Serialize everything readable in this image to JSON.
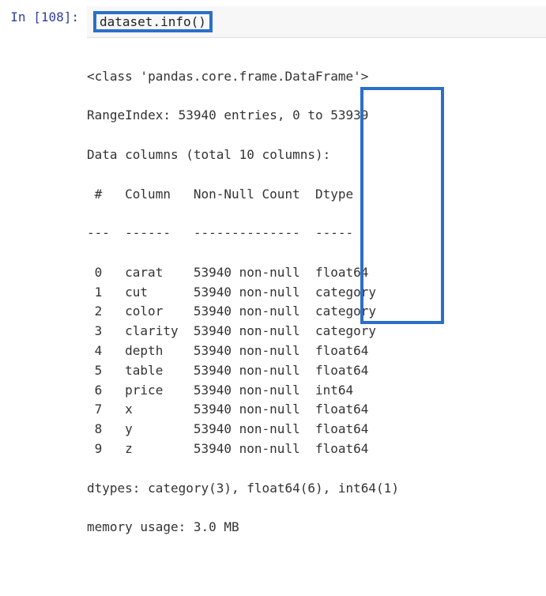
{
  "cell": {
    "prompt": "In [108]:",
    "code": "dataset.info()"
  },
  "output": {
    "class_line": "<class 'pandas.core.frame.DataFrame'>",
    "rangeindex": "RangeIndex: 53940 entries, 0 to 53939",
    "datacols": "Data columns (total 10 columns):",
    "header": {
      "idx": " #  ",
      "col": "Column",
      "nn": "Non-Null Count",
      "dtype": "Dtype"
    },
    "divider": {
      "idx": "--- ",
      "col": "------",
      "nn": "--------------",
      "dtype": "-----"
    },
    "rows": [
      {
        "idx": " 0  ",
        "col": "carat",
        "nn": "53940 non-null",
        "dtype": "float64"
      },
      {
        "idx": " 1  ",
        "col": "cut",
        "nn": "53940 non-null",
        "dtype": "category"
      },
      {
        "idx": " 2  ",
        "col": "color",
        "nn": "53940 non-null",
        "dtype": "category"
      },
      {
        "idx": " 3  ",
        "col": "clarity",
        "nn": "53940 non-null",
        "dtype": "category"
      },
      {
        "idx": " 4  ",
        "col": "depth",
        "nn": "53940 non-null",
        "dtype": "float64"
      },
      {
        "idx": " 5  ",
        "col": "table",
        "nn": "53940 non-null",
        "dtype": "float64"
      },
      {
        "idx": " 6  ",
        "col": "price",
        "nn": "53940 non-null",
        "dtype": "int64"
      },
      {
        "idx": " 7  ",
        "col": "x",
        "nn": "53940 non-null",
        "dtype": "float64"
      },
      {
        "idx": " 8  ",
        "col": "y",
        "nn": "53940 non-null",
        "dtype": "float64"
      },
      {
        "idx": " 9  ",
        "col": "z",
        "nn": "53940 non-null",
        "dtype": "float64"
      }
    ],
    "dtypes_summary": "dtypes: category(3), float64(6), int64(1)",
    "memory": "memory usage: 3.0 MB"
  },
  "chart_data": {
    "type": "table",
    "title": "dataset.info()",
    "columns": [
      "#",
      "Column",
      "Non-Null Count",
      "Dtype"
    ],
    "rows": [
      [
        0,
        "carat",
        "53940 non-null",
        "float64"
      ],
      [
        1,
        "cut",
        "53940 non-null",
        "category"
      ],
      [
        2,
        "color",
        "53940 non-null",
        "category"
      ],
      [
        3,
        "clarity",
        "53940 non-null",
        "category"
      ],
      [
        4,
        "depth",
        "53940 non-null",
        "float64"
      ],
      [
        5,
        "table",
        "53940 non-null",
        "float64"
      ],
      [
        6,
        "price",
        "53940 non-null",
        "int64"
      ],
      [
        7,
        "x",
        "53940 non-null",
        "float64"
      ],
      [
        8,
        "y",
        "53940 non-null",
        "float64"
      ],
      [
        9,
        "z",
        "53940 non-null",
        "float64"
      ]
    ],
    "range_index": {
      "entries": 53940,
      "start": 0,
      "stop": 53939
    },
    "dtypes_counts": {
      "category": 3,
      "float64": 6,
      "int64": 1
    },
    "memory_usage": "3.0 MB"
  }
}
